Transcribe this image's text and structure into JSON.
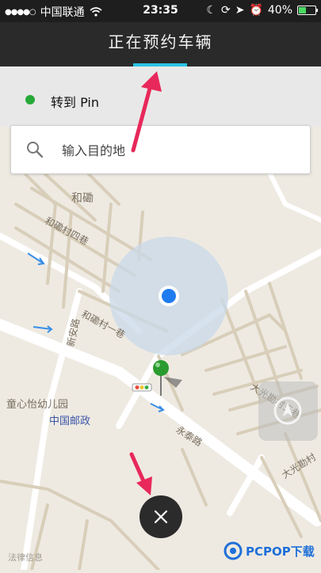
{
  "status": {
    "carrier": "中国联通",
    "time": "23:35",
    "battery": "40%",
    "battery_level": 0.4,
    "icons": [
      "signal-icon",
      "wifi-icon",
      "moon-icon",
      "rotation-lock-icon",
      "location-icon",
      "alarm-icon",
      "battery-icon"
    ]
  },
  "nav": {
    "title": "正在预约车辆",
    "accent": "#29c3e4"
  },
  "pickup": {
    "label": "转到 Pin",
    "dot_color": "#27a939"
  },
  "search": {
    "placeholder": "输入目的地"
  },
  "map": {
    "labels": [
      "和磡",
      "和磡村四巷",
      "和磡村一巷",
      "新安路",
      "童心怡幼儿园",
      "中国邮政",
      "永泰路",
      "大光勘村五巷",
      "大光勘村",
      "法律信息"
    ]
  },
  "watermark": {
    "brand": "PCPOP下载"
  },
  "colors": {
    "user_location": "#1e7cf0",
    "pin": "#2a9b2f",
    "annotation_arrow": "#e8285a"
  }
}
